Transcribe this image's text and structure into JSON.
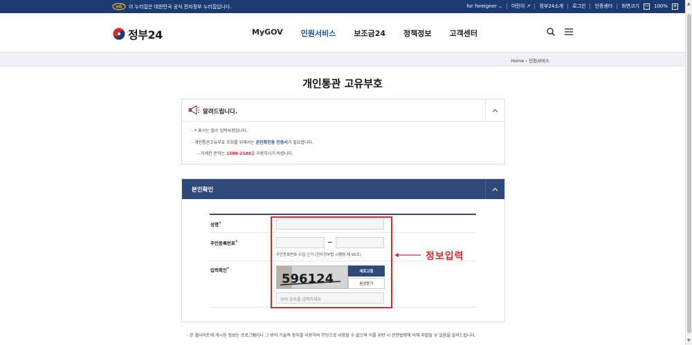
{
  "topbar": {
    "gov_text": "이 누리집은 대한민국 공식 전자정부 누리집입니다.",
    "foreigner": "for foreigner",
    "kids": "어린이",
    "about": "정부24소개",
    "login": "로그인",
    "cert": "인증센터",
    "screen_size": "화면크기",
    "zoom": "100%",
    "zoom_minus": "−",
    "zoom_plus": "+"
  },
  "header": {
    "logo_text": "정부24",
    "nav": [
      "MyGOV",
      "민원서비스",
      "보조금24",
      "정책정보",
      "고객센터"
    ],
    "active_nav": "민원서비스"
  },
  "breadcrumb": {
    "home": "Home",
    "current": "민원서비스"
  },
  "page_title": "개인통관 고유부호",
  "notice": {
    "title": "알려드립니다.",
    "line1_prefix": "-",
    "line1_star": "*",
    "line1_text": "표시는 필수 입력사항입니다.",
    "line2_prefix": "-",
    "line2_a": "개인통관고유부호 조회를 위해서는",
    "line2_link": "본인확인용 인증서",
    "line2_b": "가 필요합니다.",
    "line3_a": "- 자세한 문의는",
    "line3_phone": "1588-2188",
    "line3_b": "을 이용하시기 바랍니다."
  },
  "panel": {
    "title": "본인확인",
    "name_label": "성명",
    "rrn_label": "주민등록번호",
    "rrn_note": "주민등록번호 수집 근거 (전자정부법 시행령 제 90조)",
    "captcha_label": "입력확인",
    "captcha_text": "596124",
    "refresh_button": "새로고침",
    "audio_button": "음성듣기",
    "captcha_placeholder": "위의 숫자를 입력하세요",
    "required_mark": "*"
  },
  "annotation": {
    "text": "정보입력",
    "color": "#e5242a"
  },
  "footer_note": "- 본 웹사이트에 게시된 정보는 프로그램이나 그 밖의 기술적 장치를 이용하여 무단으로 사용할 수 없으며 이를 위반 시 관련법령에 의해 처벌될 수 있음을 알려드립니다.",
  "colors": {
    "navy": "#1b3a71",
    "panel_head": "#2f4a7a",
    "accent": "#1a52a6",
    "red": "#e0252c"
  }
}
